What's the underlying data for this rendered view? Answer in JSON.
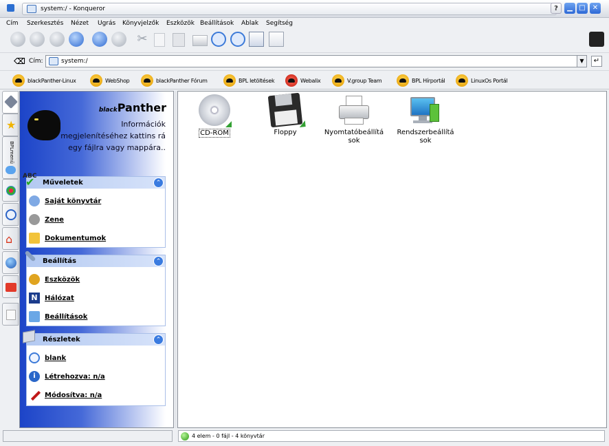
{
  "window": {
    "title": "system:/ - Konqueror"
  },
  "window_buttons": {
    "help": "?",
    "minimize": "▁",
    "maximize": "□",
    "close": "✕"
  },
  "menu": [
    "Cím",
    "Szerkesztés",
    "Nézet",
    "Ugrás",
    "Könyvjelzők",
    "Eszközök",
    "Beállítások",
    "Ablak",
    "Segítség"
  ],
  "address": {
    "label": "Cím:",
    "value": "system:/"
  },
  "bookmarks": [
    "blackPanther-Linux",
    "WebShop",
    "blackPanther Fórum",
    "BPL letöltések",
    "Webalix",
    "V.group Team",
    "BPL Hírportál",
    "LinuxOs Portál"
  ],
  "sidebar": {
    "vtab_label": "BPLmenü",
    "brand_prefix": "black",
    "brand_name": "Panther",
    "info_text": "Információk megjelenítéséhez kattins rá egy fájlra vagy mappára..",
    "sections": [
      {
        "title": "Műveletek",
        "items": [
          "Saját könyvtár",
          "Zene",
          "Dokumentumok"
        ]
      },
      {
        "title": "Beállítás",
        "items": [
          "Eszközök",
          "Hálózat",
          "Beállítások"
        ]
      },
      {
        "title": "Részletek",
        "items": [
          "blank",
          "Létrehozva: n/a",
          "Módosítva: n/a"
        ]
      }
    ]
  },
  "files": [
    {
      "name": "CD-ROM"
    },
    {
      "name": "Floppy"
    },
    {
      "name": "Nyomtatóbeállítá sok"
    },
    {
      "name": "Rendszerbeállítá sok"
    }
  ],
  "status": {
    "text": "4 elem - 0 fájl - 4 könyvtár"
  }
}
